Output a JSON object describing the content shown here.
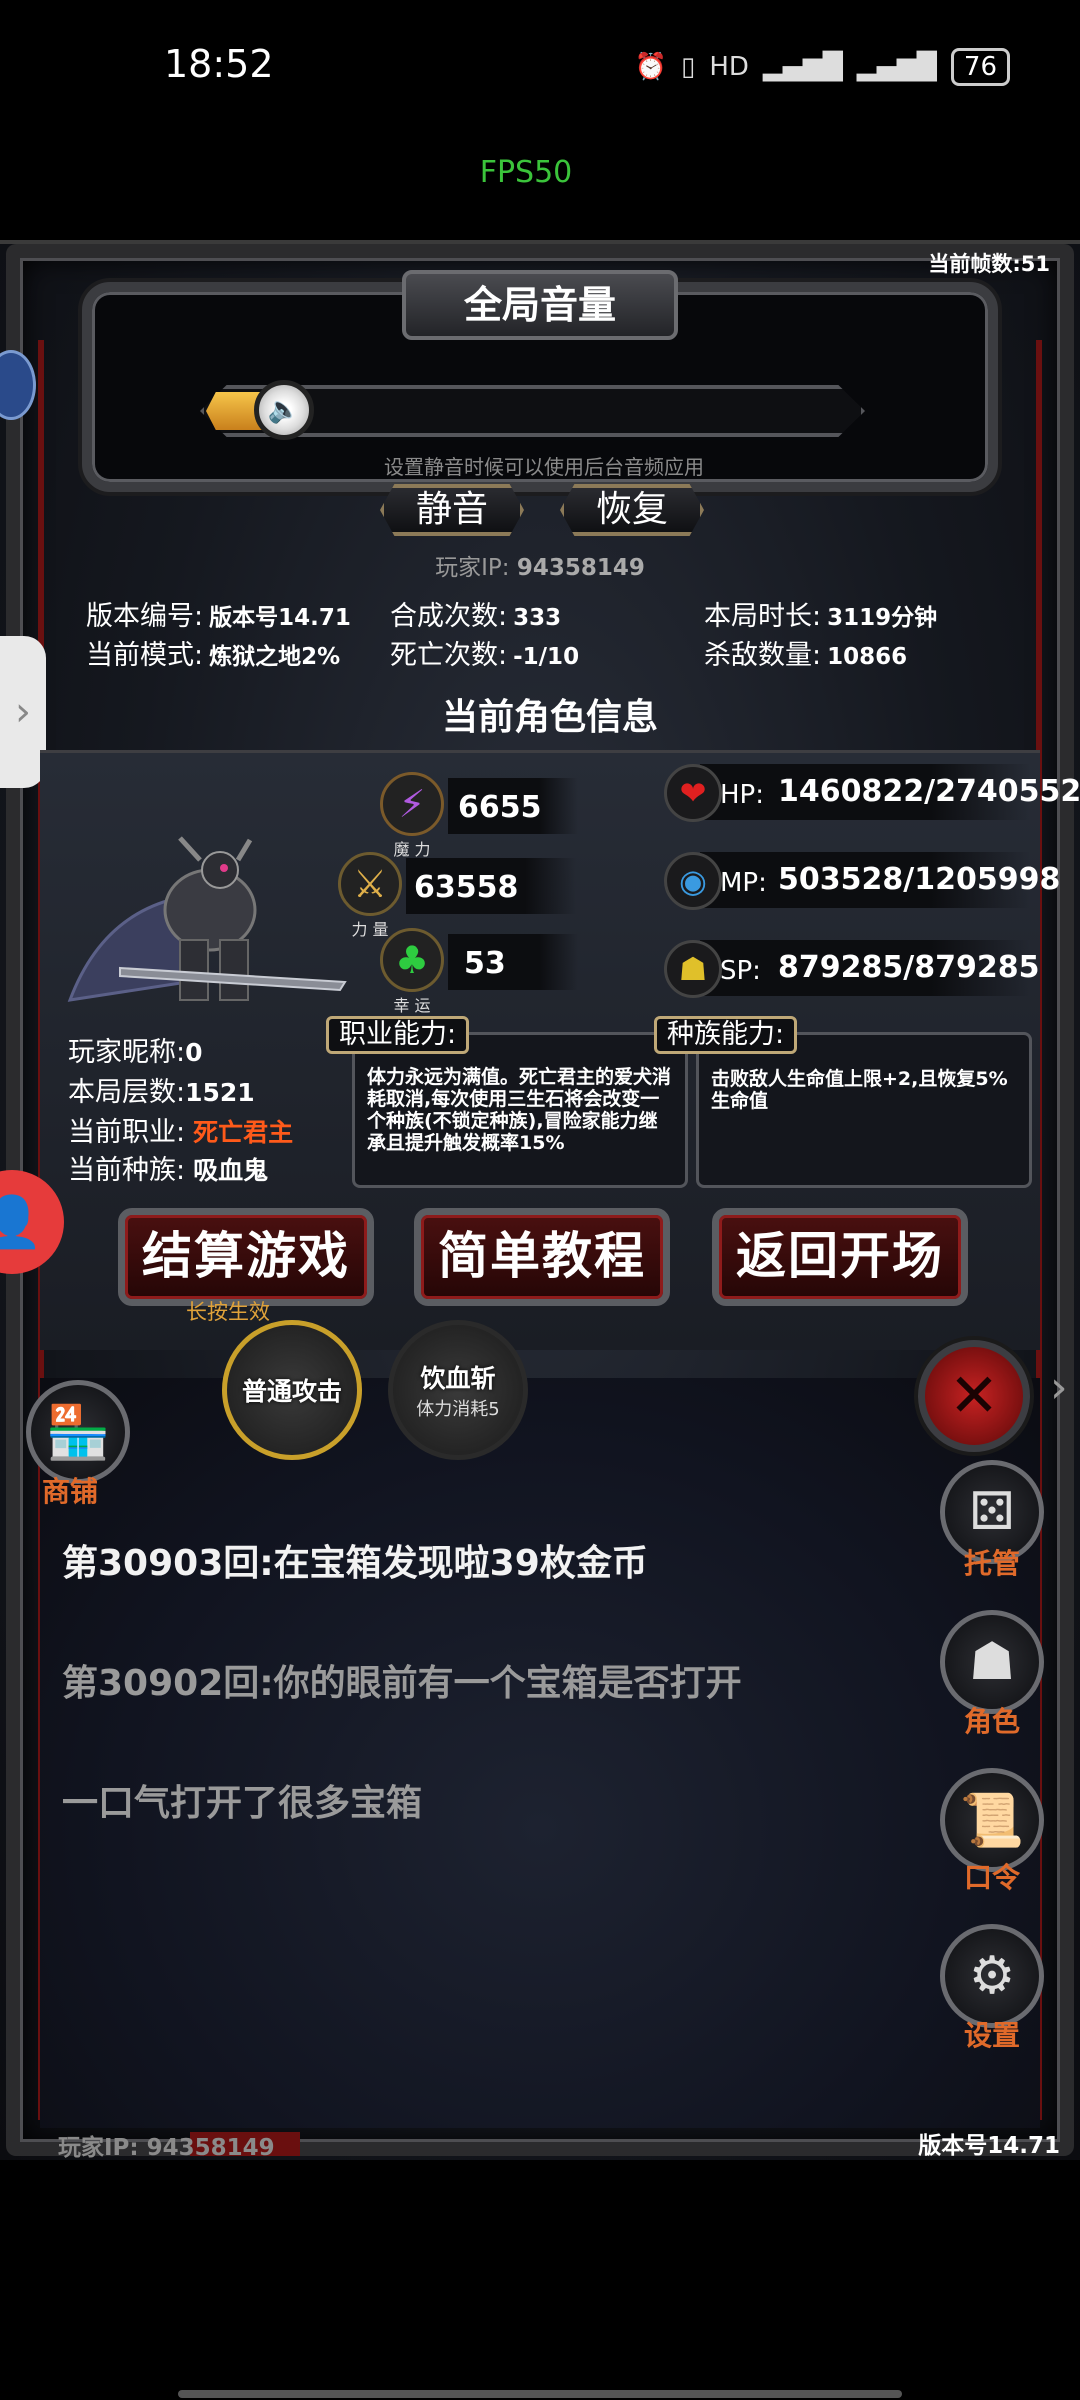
{
  "status_bar": {
    "time": "18:52",
    "icons": [
      "alarm-icon",
      "vibrate-icon",
      "hd-icon",
      "signal-5g-icon",
      "signal-5g-2-icon"
    ],
    "hd": "HD",
    "battery": "76"
  },
  "fps": "FPS50",
  "current_frames": "当前帧数:51",
  "volume": {
    "title": "全局音量",
    "level_fraction": 0.05,
    "hint": "设置静音时候可以使用后台音频应用",
    "mute_label": "静音",
    "restore_label": "恢复"
  },
  "player_ip": {
    "label": "玩家IP:",
    "value": "94358149"
  },
  "stats": {
    "version_label": "版本编号:",
    "version_value": "版本号14.71",
    "mode_label": "当前模式:",
    "mode_value": "炼狱之地2%",
    "synth_label": "合成次数:",
    "synth_value": "333",
    "death_label": "死亡次数:",
    "death_value": "-1/10",
    "duration_label": "本局时长:",
    "duration_value": "3119分钟",
    "kills_label": "杀敌数量:",
    "kills_value": "10866"
  },
  "character": {
    "section_title": "当前角色信息",
    "attrs": [
      {
        "icon": "magic-icon",
        "label": "魔 力",
        "value": "6655"
      },
      {
        "icon": "strength-icon",
        "label": "力 量",
        "value": "63558"
      },
      {
        "icon": "luck-clover-icon",
        "label": "幸 运",
        "value": "53"
      }
    ],
    "hp_label": "HP:",
    "hp_value": "1460822/2740552",
    "mp_label": "MP:",
    "mp_value": "503528/1205998",
    "sp_label": "SP:",
    "sp_value": "879285/879285",
    "nickname_label": "玩家昵称:",
    "nickname_value": "0",
    "floors_label": "本局层数:",
    "floors_value": "1521",
    "job_label": "当前职业:",
    "job_value": "死亡君主",
    "job_color": "#ff5a1a",
    "race_label": "当前种族:",
    "race_value": "吸血鬼",
    "job_ability_tag": "职业能力:",
    "job_ability_text": "体力永远为满值。死亡君主的爱犬消耗取消,每次使用三生石将会改变一个种族(不锁定种族),冒险家能力继承且提升触发概率15%",
    "race_ability_tag": "种族能力:",
    "race_ability_text": "击败敌人生命值上限+2,且恢复5%生命值"
  },
  "actions": {
    "settle_label": "结算游戏",
    "settle_hint": "长按生效",
    "tutorial_label": "简单教程",
    "back_label": "返回开场"
  },
  "skills": [
    {
      "label": "普通攻击",
      "sub": ""
    },
    {
      "label": "饮血斩",
      "sub": "体力消耗5"
    }
  ],
  "side_menu": {
    "shop_label": "商铺",
    "auto_label": "托管",
    "role_label": "角色",
    "code_label": "口令",
    "settings_label": "设置"
  },
  "log": [
    {
      "text": "第30903回:在宝箱发现啦39枚金币",
      "color": "#f2f2f2"
    },
    {
      "text": "第30902回:你的眼前有一个宝箱是否打开",
      "color": "#9a9a9a"
    },
    {
      "text": "一口气打开了很多宝箱",
      "color": "#9a9a9a"
    }
  ],
  "footer": {
    "ip_text": "玩家IP: 94358149",
    "version_text": "版本号14.71"
  }
}
